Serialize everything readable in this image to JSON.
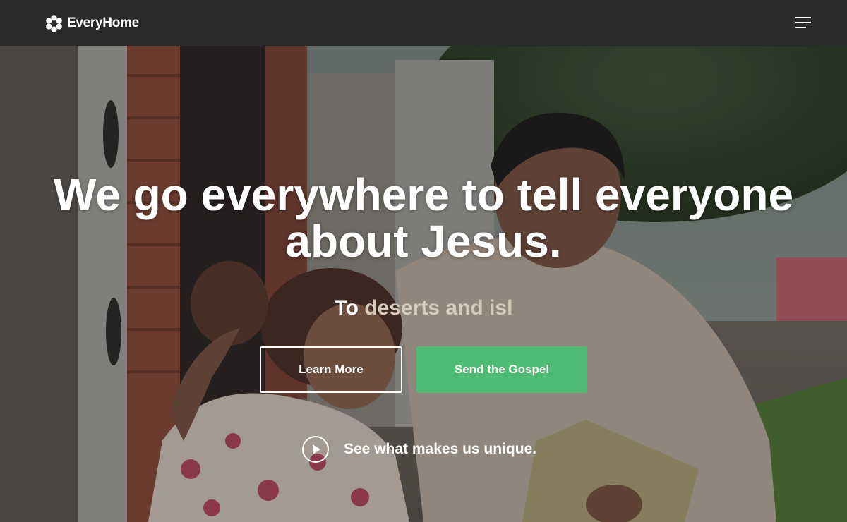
{
  "header": {
    "logo_text": "EveryHome",
    "logo_icon": "flower-icon",
    "menu_icon": "hamburger-menu-icon"
  },
  "hero": {
    "headline": "We go everywhere to tell everyone about Jesus.",
    "subline_static": "To",
    "subline_typed": "deserts and isl",
    "buttons": {
      "learn_more": "Learn More",
      "send_gospel": "Send the Gospel"
    },
    "video_link": {
      "icon": "play-icon",
      "label": "See what makes us unique."
    }
  },
  "colors": {
    "header_bg": "#2b2a2b",
    "accent_green": "#4fba73",
    "typed_text": "#d6cbb9",
    "text": "#ffffff"
  }
}
